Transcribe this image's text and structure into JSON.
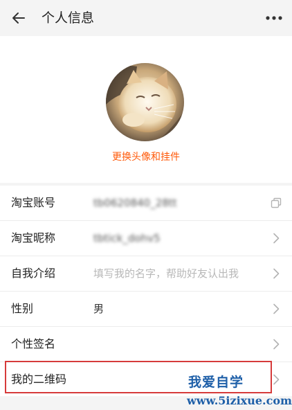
{
  "header": {
    "back_icon": "arrow-left-icon",
    "title": "个人信息",
    "more_icon": "more-horizontal-icon"
  },
  "avatar": {
    "change_label": "更换头像和挂件",
    "accent": "#ff5a0a"
  },
  "rows": [
    {
      "label": "淘宝账号",
      "value": "tb0620840_28tt",
      "action_icon": "copy-icon"
    },
    {
      "label": "淘宝昵称",
      "value": "tbtick_dohv5",
      "action_icon": "chevron-right-icon"
    },
    {
      "label": "自我介绍",
      "placeholder": "填写我的名字，帮助好友认出我",
      "action_icon": "chevron-right-icon"
    },
    {
      "label": "性别",
      "value": "男",
      "action_icon": "chevron-right-icon"
    },
    {
      "label": "个性签名",
      "value": "",
      "action_icon": "chevron-right-icon"
    },
    {
      "label": "我的二维码",
      "value": "",
      "action_icon": "chevron-right-icon"
    }
  ],
  "watermark": {
    "title": "我爱自学",
    "url": "www.5izixue.com",
    "color": "#1e5fa8"
  },
  "highlight_color": "#d63a3a"
}
